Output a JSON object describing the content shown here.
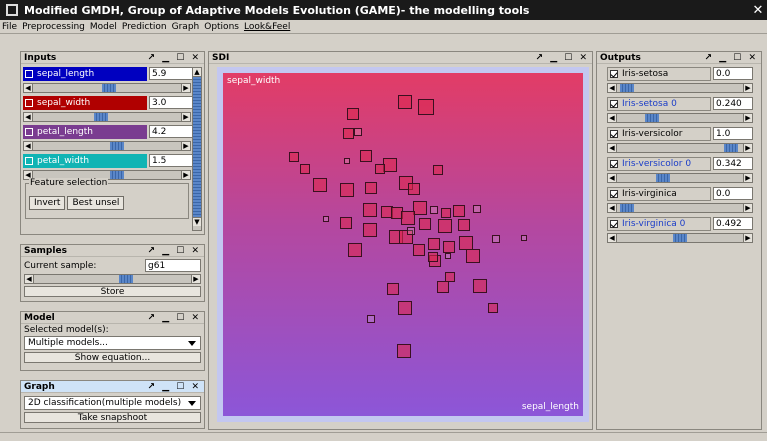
{
  "window": {
    "title": "Modified GMDH, Group of Adaptive Models Evolution (GAME)- the modelling tools"
  },
  "menu": [
    "File",
    "Preprocessing",
    "Model",
    "Prediction",
    "Graph",
    "Options",
    "Look&Feel"
  ],
  "inputs": {
    "title": "Inputs",
    "items": [
      {
        "label": "sepal_length",
        "value": "5.9",
        "color": "#0000c0",
        "slider_pos": 0.5
      },
      {
        "label": "sepal_width",
        "value": "3.0",
        "color": "#b00000",
        "slider_pos": 0.45
      },
      {
        "label": "petal_length",
        "value": "4.2",
        "color": "#7a3c90",
        "slider_pos": 0.55
      },
      {
        "label": "petal_width",
        "value": "1.5",
        "color": "#10b4b4",
        "slider_pos": 0.55
      }
    ],
    "feature_selection": "Feature selection",
    "invert": "Invert",
    "best_unsel": "Best unsel"
  },
  "samples": {
    "title": "Samples",
    "current_label": "Current sample:",
    "current_value": "g61",
    "store": "Store"
  },
  "model": {
    "title": "Model",
    "selected_label": "Selected model(s):",
    "selected_value": "Multiple models...",
    "show_equation": "Show equation..."
  },
  "graph": {
    "title": "Graph",
    "type_value": "2D classification(multiple models)",
    "snapshot": "Take snapshoot"
  },
  "sdi": {
    "title": "SDI",
    "y_axis": "sepal_width",
    "x_axis": "sepal_length"
  },
  "outputs": {
    "title": "Outputs",
    "items": [
      {
        "label": "Iris-setosa",
        "value": "0.0",
        "highlight": false,
        "slider_pos": 0.02
      },
      {
        "label": "Iris-setosa 0",
        "value": "0.240",
        "highlight": true,
        "slider_pos": 0.24
      },
      {
        "label": "Iris-versicolor",
        "value": "1.0",
        "highlight": false,
        "slider_pos": 0.95
      },
      {
        "label": "Iris-versicolor 0",
        "value": "0.342",
        "highlight": true,
        "slider_pos": 0.34
      },
      {
        "label": "Iris-virginica",
        "value": "0.0",
        "highlight": false,
        "slider_pos": 0.02
      },
      {
        "label": "Iris-virginica 0",
        "value": "0.492",
        "highlight": true,
        "slider_pos": 0.49
      }
    ]
  },
  "frame_controls": "↗ ▁ ☐ ✕"
}
